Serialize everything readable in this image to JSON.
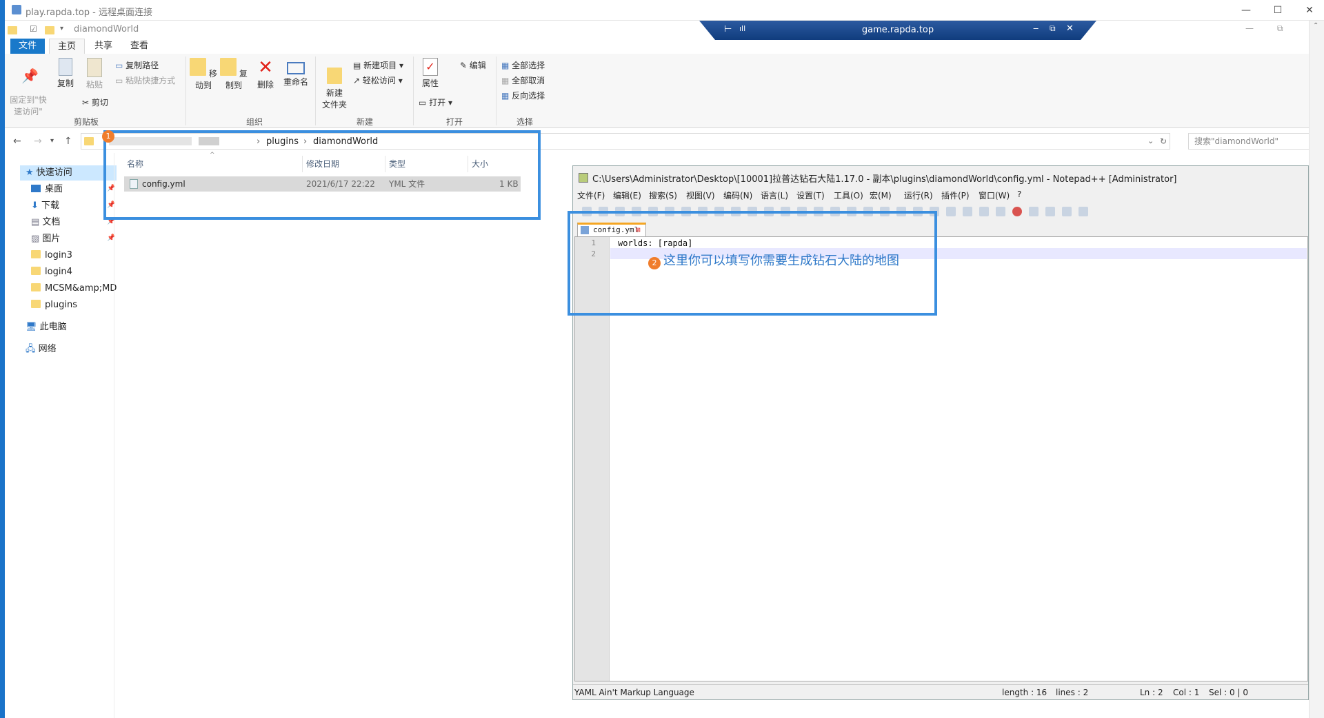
{
  "rdp": {
    "window_title": "play.rapda.top - 远程桌面连接",
    "connection_host": "game.rapda.top",
    "minimize": "—",
    "maximize": "☐",
    "close": "✕"
  },
  "explorer": {
    "window_title": "diamondWorld",
    "tabs": [
      "文件",
      "主页",
      "共享",
      "查看"
    ],
    "ribbon": {
      "clipboard": {
        "pin": "固定到\"快\n速访问\"",
        "copy": "复制",
        "paste": "粘贴",
        "copy_path": "复制路径",
        "paste_shortcut": "粘贴快捷方式",
        "cut": "剪切",
        "group": "剪贴板"
      },
      "organize": {
        "move_to": "移动到",
        "copy_to": "复制到",
        "delete": "删除",
        "rename": "重命名",
        "group": "组织"
      },
      "new": {
        "new_folder": "新建\n文件夹",
        "new_item": "新建项目 ▾",
        "easy_access": "轻松访问 ▾",
        "group": "新建"
      },
      "open": {
        "properties": "属性",
        "open": "打开 ▾",
        "edit": "编辑",
        "group": "打开"
      },
      "select": {
        "select_all": "全部选择",
        "select_none": "全部取消",
        "invert": "反向选择",
        "group": "选择"
      }
    },
    "address": {
      "crumbs": [
        "plugins",
        "diamondWorld"
      ],
      "search_placeholder": "搜索\"diamondWorld\""
    },
    "nav": {
      "quick_access": "快速访问",
      "items": [
        "桌面",
        "下载",
        "文档",
        "图片",
        "login3",
        "login4",
        "MCSM&amp;MDU",
        "plugins"
      ],
      "this_pc": "此电脑",
      "network": "网络"
    },
    "columns": [
      "名称",
      "修改日期",
      "类型",
      "大小"
    ],
    "files": [
      {
        "name": "config.yml",
        "modified": "2021/6/17 22:22",
        "type": "YML 文件",
        "size": "1 KB"
      }
    ],
    "badge1": "1"
  },
  "notepad": {
    "title": "C:\\Users\\Administrator\\Desktop\\[10001]拉普达钻石大陆1.17.0 - 副本\\plugins\\diamondWorld\\config.yml - Notepad++ [Administrator]",
    "menu": [
      "文件(F)",
      "编辑(E)",
      "搜索(S)",
      "视图(V)",
      "编码(N)",
      "语言(L)",
      "设置(T)",
      "工具(O)",
      "宏(M)",
      "运行(R)",
      "插件(P)",
      "窗口(W)",
      "?"
    ],
    "tab": "config.yml",
    "lines": [
      {
        "n": "1",
        "text": "worlds: [rapda]"
      },
      {
        "n": "2",
        "text": ""
      }
    ],
    "annotation": "这里你可以填写你需要生成钻石大陆的地图",
    "badge2": "2",
    "status": {
      "lang": "YAML Ain't Markup Language",
      "length": "length : 16",
      "lines": "lines : 2",
      "ln": "Ln : 2",
      "col": "Col : 1",
      "sel": "Sel : 0 | 0"
    }
  },
  "colors": {
    "accent": "#1979ca",
    "highlight": "#3b8fdf",
    "badge": "#f07d2c"
  }
}
